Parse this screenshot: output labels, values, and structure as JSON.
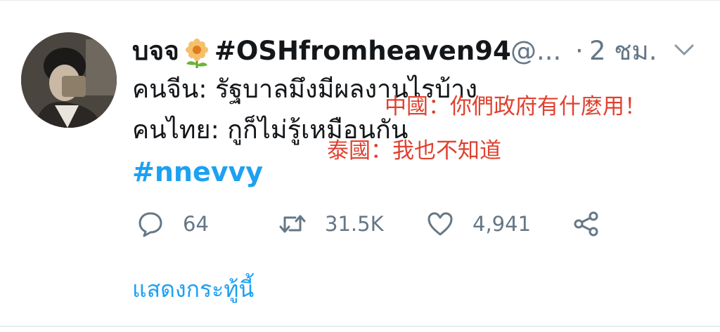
{
  "tweet": {
    "display_name": "บจจ",
    "name_tag": "#OSHfromheaven94",
    "handle": "@...",
    "separator": "·",
    "time": "2 ชม.",
    "lines": [
      "คนจีน: รัฐบาลมึงมีผลงานไรบ้าง",
      "คนไทย: กูก็ไม่รู้เหมือนกัน"
    ],
    "hashtag": "#nnevvy",
    "overlay_text": [
      "中國：你們政府有什麼用！",
      "泰國：我也不知道"
    ],
    "overlay_color": "#e0412f",
    "accent_color": "#1da1f2",
    "muted_color": "#657786"
  },
  "actions": {
    "reply": {
      "icon": "reply-icon",
      "count": "64"
    },
    "retweet": {
      "icon": "retweet-icon",
      "count": "31.5K"
    },
    "like": {
      "icon": "heart-icon",
      "count": "4,941"
    },
    "share": {
      "icon": "share-icon"
    }
  },
  "show_thread_label": "แสดงกระทู้นี้"
}
